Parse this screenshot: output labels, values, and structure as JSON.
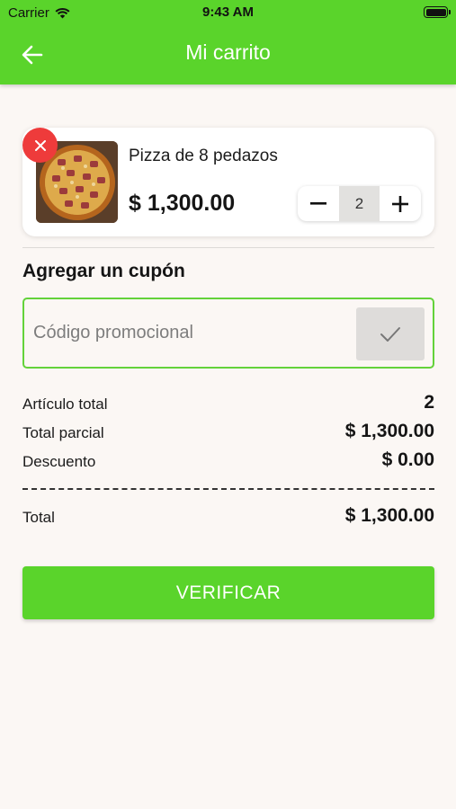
{
  "status_bar": {
    "carrier": "Carrier",
    "time": "9:43 AM"
  },
  "header": {
    "title": "Mi carrito",
    "back_icon": "arrow-left-icon"
  },
  "cart_item": {
    "name": "Pizza de 8 pedazos",
    "price": "$ 1,300.00",
    "quantity": "2",
    "image": "pizza-photo",
    "remove_icon": "close-icon"
  },
  "coupon": {
    "title": "Agregar un cupón",
    "placeholder": "Código promocional",
    "value": "",
    "apply_icon": "check-icon"
  },
  "summary": {
    "items_label": "Artículo total",
    "items_value": "2",
    "subtotal_label": "Total parcial",
    "subtotal_value": "$ 1,300.00",
    "discount_label": "Descuento",
    "discount_value": "$ 0.00",
    "total_label": "Total",
    "total_value": "$ 1,300.00"
  },
  "checkout": {
    "label": "VERIFICAR"
  },
  "colors": {
    "primary": "#5ad42b",
    "remove": "#ee3b3b",
    "background": "#fbf7f4"
  }
}
